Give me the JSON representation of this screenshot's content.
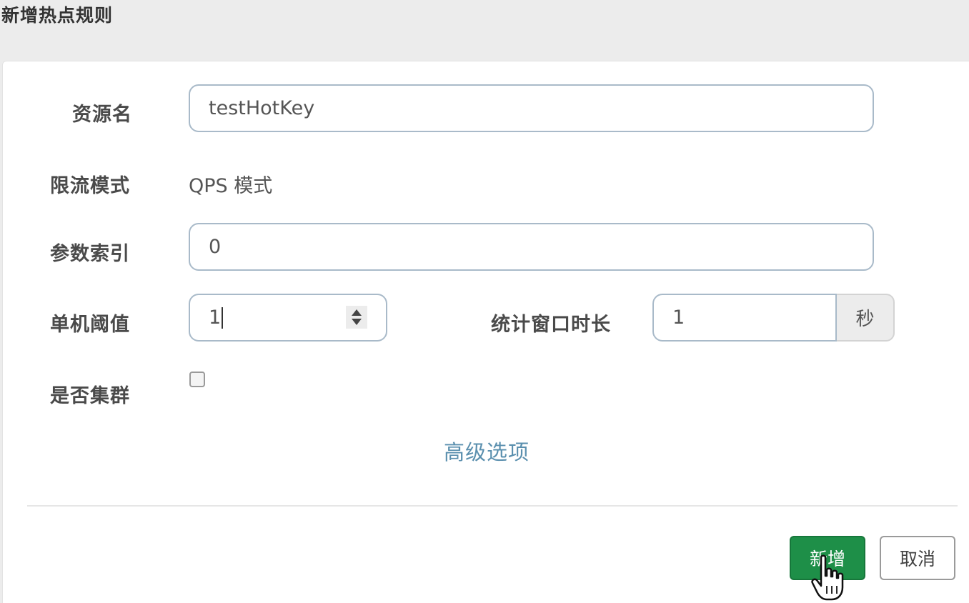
{
  "dialog": {
    "title": "新增热点规则"
  },
  "form": {
    "resource_name": {
      "label": "资源名",
      "value": "testHotKey"
    },
    "limit_mode": {
      "label": "限流模式",
      "value": "QPS 模式"
    },
    "param_index": {
      "label": "参数索引",
      "value": "0"
    },
    "threshold": {
      "label": "单机阈值",
      "value": "1"
    },
    "stat_window": {
      "label": "统计窗口时长",
      "value": "1",
      "unit": "秒"
    },
    "cluster": {
      "label": "是否集群",
      "checked": false
    },
    "advanced_link": "高级选项"
  },
  "footer": {
    "add_label": "新增",
    "cancel_label": "取消"
  },
  "icons": {
    "spinner": "up-down-arrows-icon",
    "cursor": "hand-pointer-icon"
  },
  "colors": {
    "primary": "#1e8f48",
    "link": "#5a8fae",
    "input_border": "#a9bac9"
  }
}
